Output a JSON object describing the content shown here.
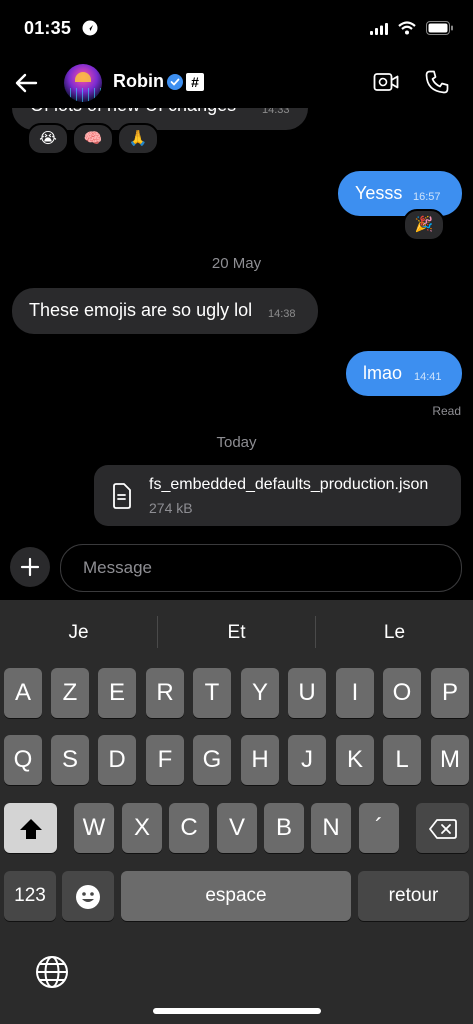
{
  "status_bar": {
    "time": "01:35"
  },
  "header": {
    "contact_name": "Robin",
    "badge": "#"
  },
  "messages": {
    "partial_text": "Of lots of new UI changes",
    "partial_time": "14:33",
    "reactions": [
      "😭",
      "🧠",
      "🙏"
    ],
    "yesss_text": "Yesss",
    "yesss_time": "16:57",
    "yesss_reaction": "🎉",
    "date_1": "20 May",
    "ugly_text": "These emojis are so ugly lol",
    "ugly_time": "14:38",
    "lmao_text": "lmao",
    "lmao_time": "14:41",
    "read_label": "Read",
    "date_2": "Today",
    "file_name": "fs_embedded_defaults_production.json",
    "file_size": "274 kB"
  },
  "composer": {
    "placeholder": "Message"
  },
  "keyboard": {
    "suggestions": [
      "Je",
      "Et",
      "Le"
    ],
    "row1": [
      "A",
      "Z",
      "E",
      "R",
      "T",
      "Y",
      "U",
      "I",
      "O",
      "P"
    ],
    "row2": [
      "Q",
      "S",
      "D",
      "F",
      "G",
      "H",
      "J",
      "K",
      "L",
      "M"
    ],
    "row3": [
      "W",
      "X",
      "C",
      "V",
      "B",
      "N",
      "´"
    ],
    "numbers_label": "123",
    "space_label": "espace",
    "return_label": "retour"
  }
}
